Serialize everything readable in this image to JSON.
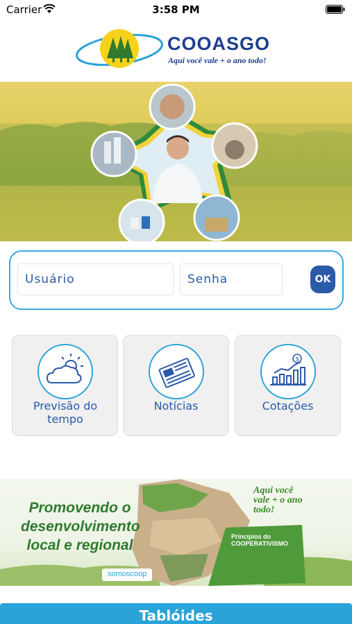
{
  "status_bar": {
    "carrier": "Carrier",
    "time": "3:58 PM"
  },
  "brand": {
    "name": "COOASGO",
    "slogan": "Aqui você vale + o ano todo!"
  },
  "login": {
    "user_placeholder": "Usuário",
    "password_placeholder": "Senha",
    "ok_label": "OK"
  },
  "cards": [
    {
      "label": "Previsão do tempo",
      "icon": "weather-icon"
    },
    {
      "label": "Notícias",
      "icon": "newspaper-icon"
    },
    {
      "label": "Cotações",
      "icon": "chart-icon"
    }
  ],
  "banner": {
    "headline": "Promovendo o desenvolvimento local e regional",
    "principles_title": "Princípios do COOPERATIVISMO",
    "slogan": "Aqui você vale + o ano todo!",
    "brand": "somoscoop"
  },
  "footer": {
    "button_label": "Tablóides"
  },
  "colors": {
    "primary_blue": "#2a5aa8",
    "accent_cyan": "#2aa3d9",
    "brand_yellow": "#f6d21a"
  }
}
